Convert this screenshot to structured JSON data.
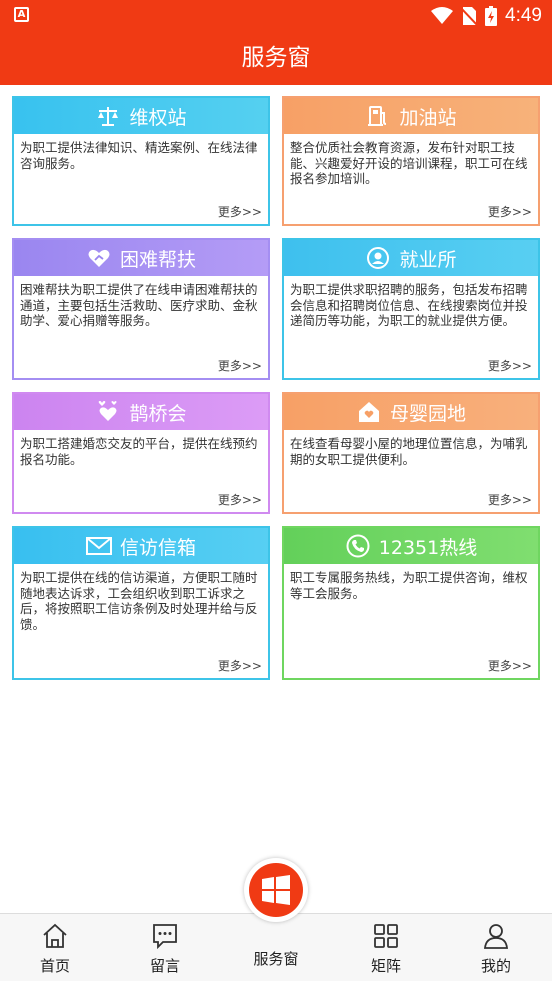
{
  "status_bar": {
    "time": "4:49",
    "app_badge": "A"
  },
  "header": {
    "title": "服务窗"
  },
  "cards": [
    {
      "title": "维权站",
      "icon": "scale-icon",
      "desc": "为职工提供法律知识、精选案例、在线法律咨询服务。",
      "more": "更多>>"
    },
    {
      "title": "加油站",
      "icon": "fuel-pump-icon",
      "desc": "整合优质社会教育资源，发布针对职工技能、兴趣爱好开设的培训课程，职工可在线报名参加培训。",
      "more": "更多>>"
    },
    {
      "title": "困难帮扶",
      "icon": "heart-hand-icon",
      "desc": "困难帮扶为职工提供了在线申请困难帮扶的通道，主要包括生活救助、医疗求助、金秋助学、爱心捐赠等服务。",
      "more": "更多>>"
    },
    {
      "title": "就业所",
      "icon": "person-circle-icon",
      "desc": "为职工提供求职招聘的服务，包括发布招聘会信息和招聘岗位信息、在线搜索岗位并投递简历等功能，为职工的就业提供方便。",
      "more": "更多>>"
    },
    {
      "title": "鹊桥会",
      "icon": "hearts-icon",
      "desc": "为职工搭建婚恋交友的平台，提供在线预约报名功能。",
      "more": "更多>>"
    },
    {
      "title": "母婴园地",
      "icon": "home-heart-icon",
      "desc": "在线查看母婴小屋的地理位置信息，为哺乳期的女职工提供便利。",
      "more": "更多>>"
    },
    {
      "title": "信访信箱",
      "icon": "envelope-icon",
      "desc": "为职工提供在线的信访渠道，方便职工随时随地表达诉求，工会组织收到职工诉求之后，将按照职工信访条例及时处理并给与反馈。",
      "more": "更多>>"
    },
    {
      "title": "12351热线",
      "icon": "phone-icon",
      "desc": "职工专属服务热线，为职工提供咨询，维权等工会服务。",
      "more": "更多>>"
    }
  ],
  "tabbar": {
    "home": "首页",
    "message": "留言",
    "service": "服务窗",
    "matrix": "矩阵",
    "mine": "我的"
  },
  "colors": {
    "brand": "#f03a14"
  }
}
